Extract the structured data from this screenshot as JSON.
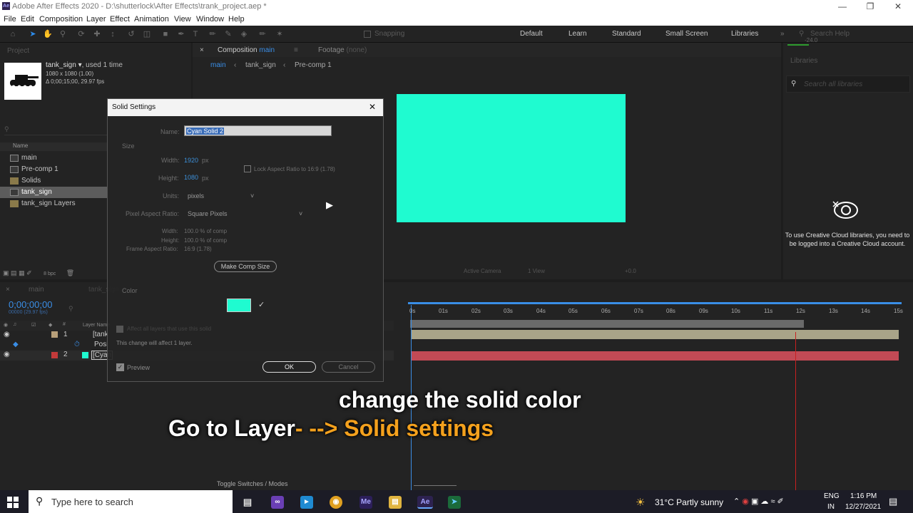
{
  "window": {
    "title": "Adobe After Effects 2020 - D:\\shutterlock\\After Effects\\trank_project.aep *",
    "app_icon": "Ae"
  },
  "menu": [
    "File",
    "Edit",
    "Composition",
    "Layer",
    "Effect",
    "Animation",
    "View",
    "Window",
    "Help"
  ],
  "workspaces": [
    "Default",
    "Learn",
    "Standard",
    "Small Screen",
    "Libraries"
  ],
  "toolbar": {
    "snapping": "Snapping",
    "search_placeholder": "Search Help"
  },
  "project": {
    "tab": "Project",
    "item_name": "tank_sign",
    "used": ", used 1 time",
    "dims": "1080 x 1080 (1.00)",
    "duration": "Δ 0;00;15;00, 29.97 fps",
    "col_name": "Name",
    "items": [
      "main",
      "Pre-comp 1",
      "Solids",
      "tank_sign",
      "tank_sign Layers"
    ],
    "bpc": "8 bpc"
  },
  "composition": {
    "tab_prefix": "Composition",
    "tab_name": "main",
    "footage_tab": "Footage",
    "footage_value": "(none)",
    "crumbs": [
      "main",
      "tank_sign",
      "Pre-comp 1"
    ],
    "view_label": "Active Camera",
    "view_count": "1 View",
    "exposure": "+0.0"
  },
  "libraries": {
    "tab": "Libraries",
    "search_placeholder": "Search all libraries",
    "message": "To use Creative Cloud libraries, you need to be logged into a Creative Cloud account.",
    "top_value": "-24.0"
  },
  "dialog": {
    "title": "Solid Settings",
    "name_label": "Name:",
    "name_value": "Cyan Solid 2",
    "size_label": "Size",
    "width_label": "Width:",
    "width_value": "1920",
    "height_label": "Height:",
    "height_value": "1080",
    "px": "px",
    "lock_label": "Lock Aspect Ratio to 16:9 (1.78)",
    "units_label": "Units:",
    "units_value": "pixels",
    "par_label": "Pixel Aspect Ratio:",
    "par_value": "Square Pixels",
    "info_width_label": "Width:",
    "info_width": "100.0 % of comp",
    "info_height_label": "Height:",
    "info_height": "100.0 % of comp",
    "far_label": "Frame Aspect Ratio:",
    "far_value": "16:9 (1.78)",
    "make_comp_size": "Make Comp Size",
    "color_label": "Color",
    "color_value": "#1ffbd0",
    "affect_all": "Affect all layers that use this solid",
    "affect_note": "This change will affect 1 layer.",
    "preview": "Preview",
    "ok": "OK",
    "cancel": "Cancel"
  },
  "timeline": {
    "tab_main": "main",
    "tab_tank": "tank_sign",
    "timecode": "0;00;00;00",
    "frame_info": "00000 (29.97 fps)",
    "col_layer": "Layer Name",
    "layers": [
      {
        "num": "1",
        "name": "[tank"
      },
      {
        "num": "",
        "name": "Posi"
      },
      {
        "num": "2",
        "name": "[Cyan"
      }
    ],
    "ticks": [
      "0s",
      "01s",
      "02s",
      "03s",
      "04s",
      "05s",
      "06s",
      "07s",
      "08s",
      "09s",
      "10s",
      "11s",
      "12s",
      "13s",
      "14s",
      "15s"
    ],
    "toggle_label": "Toggle Switches / Modes"
  },
  "subtitles": {
    "line1": "change the solid color",
    "line2_white": "Go to Layer",
    "line2_orange": "- --> Solid settings"
  },
  "taskbar": {
    "search_placeholder": "Type here to search",
    "weather": "31°C  Partly sunny",
    "lang1": "ENG",
    "lang2": "IN",
    "time": "1:16 PM",
    "date": "12/27/2021"
  }
}
